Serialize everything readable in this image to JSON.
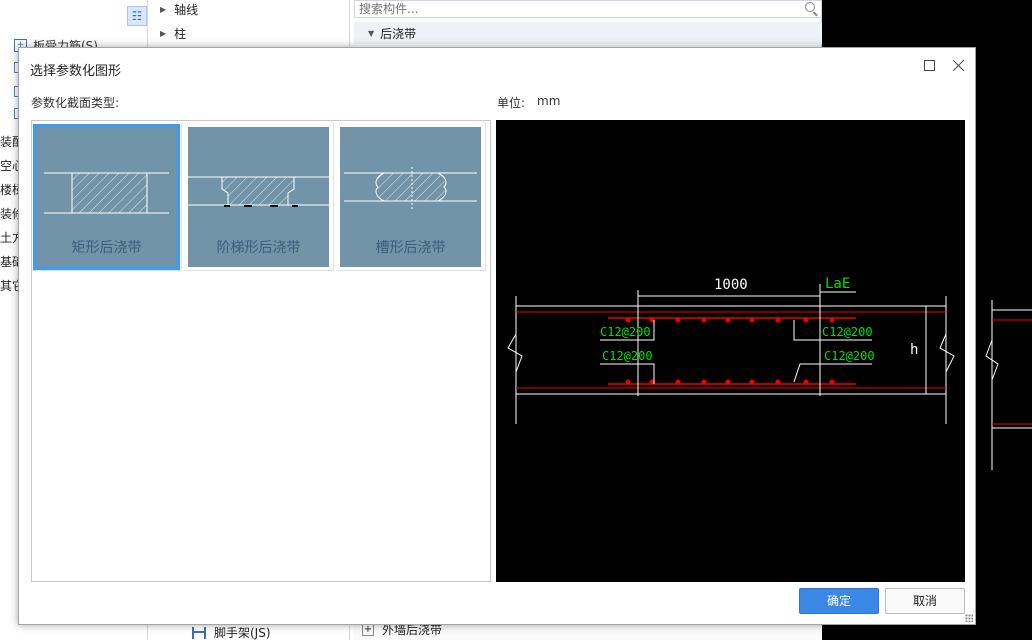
{
  "left_panel": {
    "toolbar_icon": "list-icon",
    "first_item": "板受力筋(S)",
    "items": [
      "装配",
      "空心",
      "楼梯",
      "装修",
      "土方",
      "基础",
      "其它"
    ]
  },
  "middle_panel": {
    "tree": [
      "轴线",
      "柱"
    ],
    "bottom_item": "脚手架(JS)"
  },
  "right_panel": {
    "search_placeholder": "搜索构件...",
    "group": "后浇带",
    "bottom_item": "外墙后浇带"
  },
  "dialog": {
    "title": "选择参数化图形",
    "type_label": "参数化截面类型:",
    "unit_label": "单位:",
    "unit_value": "mm",
    "shapes": [
      {
        "label": "矩形后浇带",
        "selected": true
      },
      {
        "label": "阶梯形后浇带",
        "selected": false
      },
      {
        "label": "槽形后浇带",
        "selected": false
      }
    ],
    "ok": "确定",
    "cancel": "取消",
    "colors": {
      "tile_bg": "#7194a8",
      "selection": "#3d9bf0",
      "primary": "#3b87e6"
    }
  },
  "preview": {
    "dim_width": "1000",
    "dim_lae": "LaE",
    "rebar_left_top": "C12@200",
    "rebar_left_bottom": "C12@200",
    "rebar_right_top": "C12@200",
    "rebar_right_bottom": "C12@200",
    "dim_h": "h"
  }
}
